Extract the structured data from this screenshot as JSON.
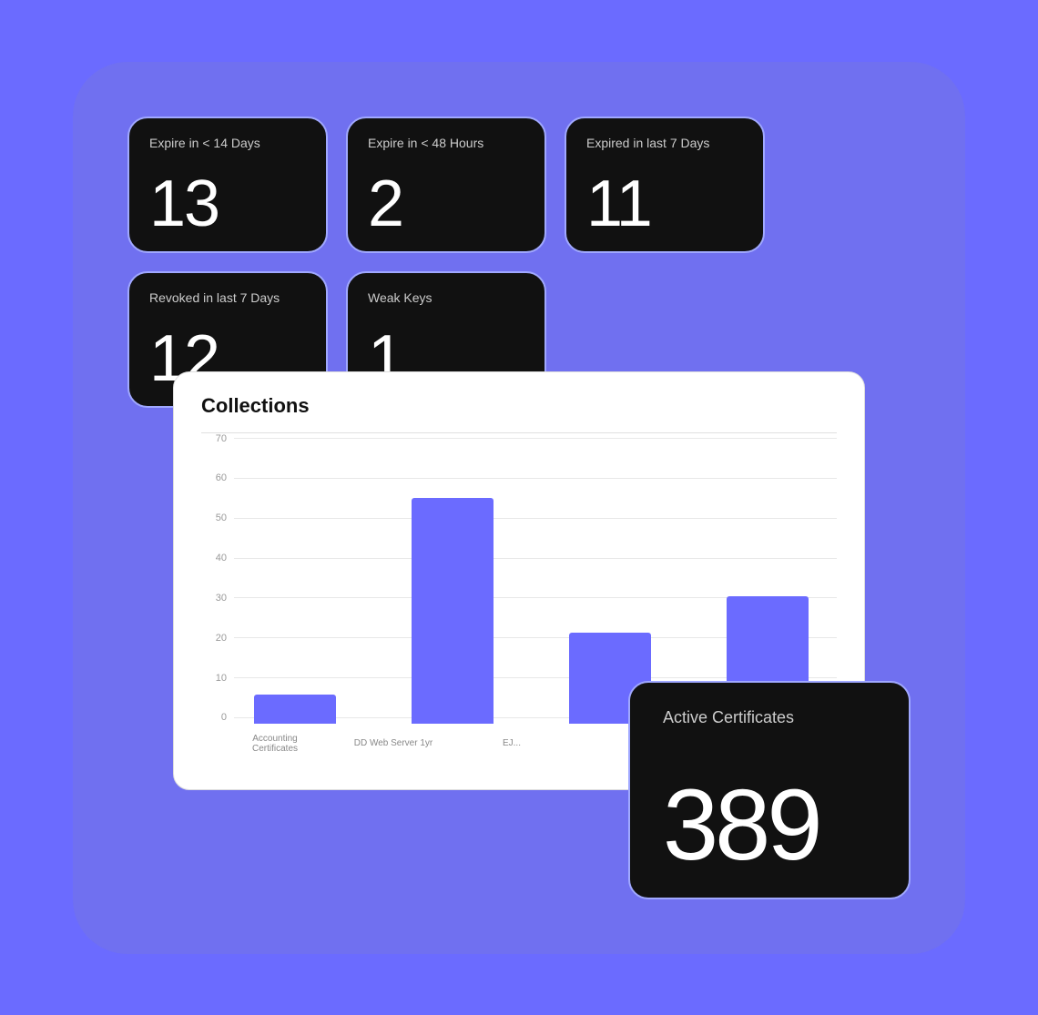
{
  "cards": {
    "expire14": {
      "label": "Expire in < 14 Days",
      "value": "13"
    },
    "expire48": {
      "label": "Expire in < 48 Hours",
      "value": "2"
    },
    "expired7": {
      "label": "Expired in last 7 Days",
      "value": "11"
    },
    "revoked": {
      "label": "Revoked in last 7 Days",
      "value": "12"
    },
    "weak": {
      "label": "Weak Keys",
      "value": "1"
    },
    "activeCerts": {
      "label": "Active Certificates",
      "value": "389"
    }
  },
  "chart": {
    "title": "Collections",
    "yLabels": [
      "70",
      "60",
      "50",
      "40",
      "30",
      "20",
      "10",
      "0"
    ],
    "bars": [
      {
        "label": "Accounting Certificates",
        "value": 8,
        "maxValue": 70
      },
      {
        "label": "DD Web Server 1yr",
        "value": 62,
        "maxValue": 70
      },
      {
        "label": "EJ...",
        "value": 25,
        "maxValue": 70
      },
      {
        "label": "",
        "value": 35,
        "maxValue": 70
      }
    ]
  }
}
